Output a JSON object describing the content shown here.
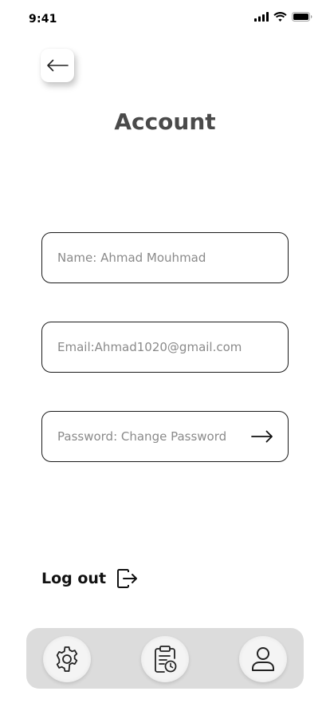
{
  "status_bar": {
    "time": "9:41"
  },
  "header": {
    "title": "Account"
  },
  "form": {
    "name": {
      "placeholder": "Name: Ahmad Mouhmad"
    },
    "email": {
      "placeholder": "Email:Ahmad1020@gmail.com"
    },
    "password": {
      "placeholder": "Password: Change Password"
    }
  },
  "logout": {
    "label": "Log out"
  },
  "tab_bar": {
    "items": [
      {
        "icon": "gear-icon"
      },
      {
        "icon": "clipboard-clock-icon"
      },
      {
        "icon": "user-icon"
      }
    ]
  },
  "colors": {
    "title": "#4a4a4a",
    "placeholder": "#8a8a8a",
    "tab_bar_bg": "#dcdcdc"
  }
}
